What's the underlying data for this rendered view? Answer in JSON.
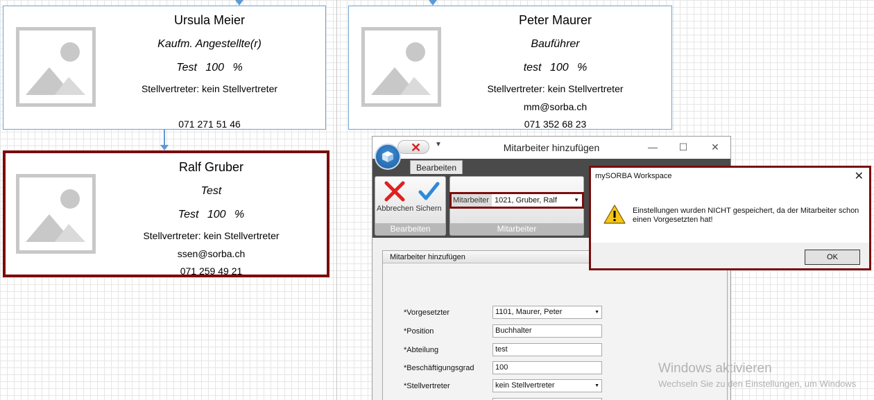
{
  "cards": [
    {
      "name": "Ursula Meier",
      "role": "Kaufm. Angestellte(r)",
      "percentage": "Test 100 %",
      "deputy": "Stellvertreter: kein Stellvertreter",
      "email": "",
      "phone": "071 271 51 46"
    },
    {
      "name": "Peter Maurer",
      "role": "Bauführer",
      "percentage": "test 100 %",
      "deputy": "Stellvertreter: kein Stellvertreter",
      "email": "mm@sorba.ch",
      "phone": "071 352 68 23"
    },
    {
      "name": "Ralf Gruber",
      "role": "Test",
      "percentage": "Test 100 %",
      "deputy": "Stellvertreter: kein Stellvertreter",
      "email": "ssen@sorba.ch",
      "phone": "071 259 49 21"
    }
  ],
  "dialog": {
    "title": "Mitarbeiter hinzufügen",
    "tab": "Bearbeiten",
    "cancel_label": "Abbrechen",
    "save_label": "Sichern",
    "group_edit_label": "Bearbeiten",
    "group_employee_label": "Mitarbeiter",
    "employee_combo_label": "Mitarbeiter",
    "employee_combo_value": "1021, Gruber, Ralf",
    "panel_title": "Mitarbeiter hinzufügen",
    "fields": [
      {
        "label": "*Vorgesetzter",
        "value": "1101, Maurer, Peter",
        "dropdown": true
      },
      {
        "label": "*Position",
        "value": "Buchhalter",
        "dropdown": false
      },
      {
        "label": "*Abteilung",
        "value": "test",
        "dropdown": false
      },
      {
        "label": "*Beschäftigungsgrad",
        "value": "100",
        "dropdown": false
      },
      {
        "label": "*Stellvertreter",
        "value": "kein Stellvertreter",
        "dropdown": true
      }
    ]
  },
  "message_box": {
    "title": "mySORBA Workspace",
    "text": "Einstellungen wurden NICHT gespeichert, da der Mitarbeiter schon einen Vorgesetzten hat!",
    "ok_label": "OK"
  },
  "watermark": {
    "line1": "Windows aktivieren",
    "line2": "Wechseln Sie zu den Einstellungen, um Windows"
  },
  "colors": {
    "selection": "#7b0c0c",
    "connector": "#5b9bd5",
    "card_border": "#6fa0d0",
    "ribbon_dark": "#4a4a4a"
  },
  "icons": [
    "image-placeholder-icon",
    "app-orb-icon",
    "cancel-x-icon",
    "save-check-icon",
    "warning-icon",
    "close-icon",
    "minimize-icon",
    "maximize-icon"
  ]
}
